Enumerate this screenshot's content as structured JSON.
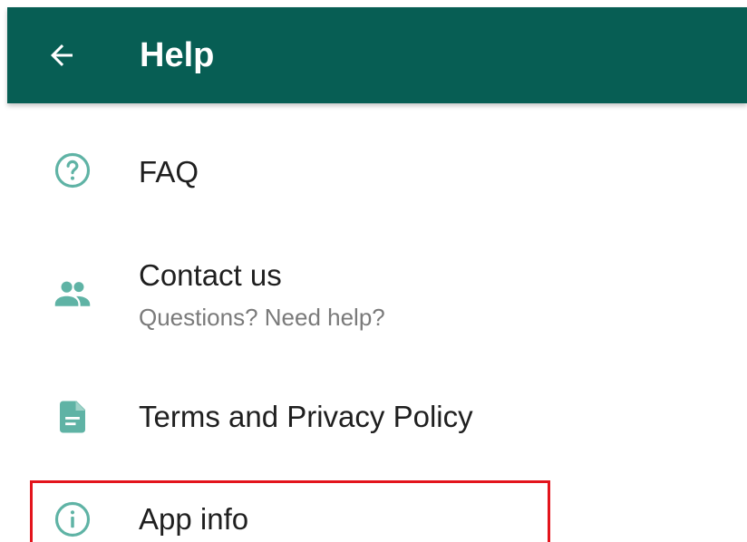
{
  "header": {
    "title": "Help",
    "back_icon": "arrow-back-icon",
    "color": "#075e54"
  },
  "menu": {
    "accent_color": "#5fb3a5",
    "items": [
      {
        "label": "FAQ",
        "icon": "help-circle-icon"
      },
      {
        "label": "Contact us",
        "subtitle": "Questions? Need help?",
        "icon": "people-icon"
      },
      {
        "label": "Terms and Privacy Policy",
        "icon": "document-icon"
      },
      {
        "label": "App info",
        "icon": "info-icon"
      }
    ]
  },
  "annotation": {
    "highlight_color": "#e3141c"
  }
}
